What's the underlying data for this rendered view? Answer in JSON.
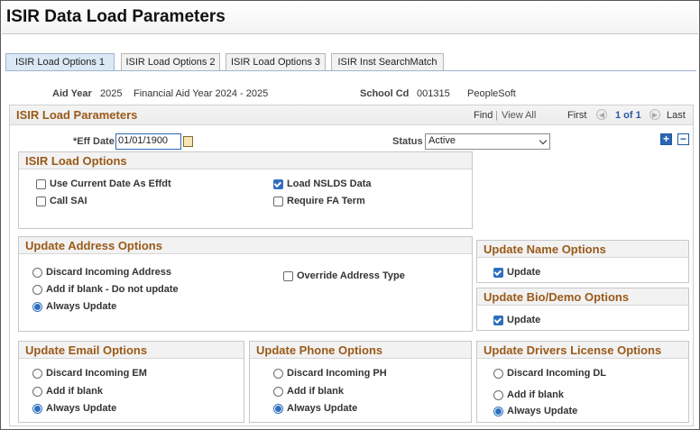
{
  "page": {
    "title": "ISIR Data Load Parameters"
  },
  "tabs": [
    {
      "label": "ISIR Load Options 1",
      "active": true
    },
    {
      "label": "ISIR Load Options 2",
      "active": false
    },
    {
      "label": "ISIR Load Options 3",
      "active": false
    },
    {
      "label": "ISIR Inst SearchMatch",
      "active": false
    }
  ],
  "header": {
    "aid_year_label": "Aid Year",
    "aid_year_value": "2025",
    "aid_year_desc": "Financial Aid Year 2024 - 2025",
    "school_cd_label": "School Cd",
    "school_cd_value": "001315",
    "school_cd_desc": "PeopleSoft"
  },
  "params": {
    "title": "ISIR Load Parameters",
    "find": "Find",
    "separator": "|",
    "view_all": "View All",
    "first": "First",
    "counter": "1 of 1",
    "last": "Last",
    "eff_date_label": "*Eff Date",
    "eff_date_value": "01/01/1900",
    "status_label": "Status",
    "status_value": "Active",
    "add_label": "+",
    "remove_label": "−"
  },
  "load_options": {
    "title": "ISIR Load Options",
    "items": [
      {
        "label": "Use Current Date As Effdt",
        "checked": false
      },
      {
        "label": "Load NSLDS Data",
        "checked": true
      },
      {
        "label": "Call SAI",
        "checked": false
      },
      {
        "label": "Require FA Term",
        "checked": false
      }
    ]
  },
  "address": {
    "title": "Update Address Options",
    "options": [
      {
        "label": "Discard Incoming Address",
        "selected": false
      },
      {
        "label": "Add if blank - Do not update",
        "selected": false
      },
      {
        "label": "Always Update",
        "selected": true
      }
    ],
    "override_label": "Override Address Type",
    "override_checked": false
  },
  "name": {
    "title": "Update Name Options",
    "update_label": "Update",
    "checked": true
  },
  "biodemo": {
    "title": "Update Bio/Demo Options",
    "update_label": "Update",
    "checked": true
  },
  "email": {
    "title": "Update Email Options",
    "options": [
      {
        "label": "Discard Incoming EM",
        "selected": false
      },
      {
        "label": "Add if blank",
        "selected": false
      },
      {
        "label": "Always Update",
        "selected": true
      }
    ]
  },
  "phone": {
    "title": "Update Phone Options",
    "options": [
      {
        "label": "Discard Incoming PH",
        "selected": false
      },
      {
        "label": "Add if blank",
        "selected": false
      },
      {
        "label": "Always Update",
        "selected": true
      }
    ]
  },
  "license": {
    "title": "Update Drivers License Options",
    "options": [
      {
        "label": "Discard Incoming DL",
        "selected": false
      },
      {
        "label": "Add if blank",
        "selected": false
      },
      {
        "label": "Always Update",
        "selected": true
      }
    ]
  }
}
